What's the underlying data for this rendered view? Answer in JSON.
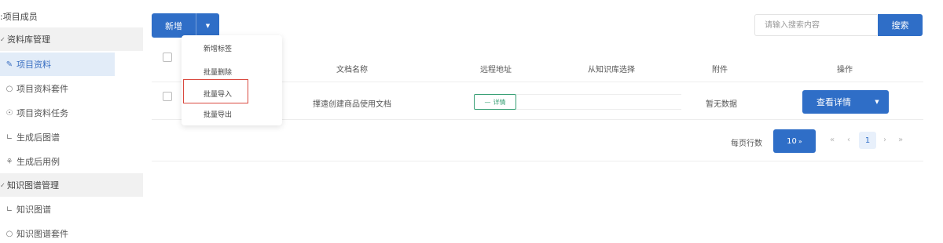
{
  "sidebar": {
    "top_item": ":项目成员",
    "groups": [
      {
        "label": "资料库管理",
        "items": [
          {
            "label": "项目资料",
            "icon": "edit-icon",
            "active": true
          },
          {
            "label": "项目资料套件",
            "icon": "circle-icon",
            "active": false
          },
          {
            "label": "项目资料任务",
            "icon": "play-circle-icon",
            "active": false
          },
          {
            "label": "生成后图谱",
            "icon": "line-chart-icon",
            "active": false
          },
          {
            "label": "生成后用例",
            "icon": "bug-icon",
            "active": false
          }
        ]
      },
      {
        "label": "知识图谱管理",
        "items": [
          {
            "label": "知识图谱",
            "icon": "line-chart-icon",
            "active": false
          },
          {
            "label": "知识图谱套件",
            "icon": "circle-icon",
            "active": false
          }
        ]
      }
    ]
  },
  "toolbar": {
    "new_label": "新增",
    "new_menu": [
      "新增标签",
      "批量删除",
      "批量导入",
      "批量导出"
    ],
    "highlighted_menu_item": "批量导入",
    "search_placeholder": "请输入搜索内容",
    "search_label": "搜索"
  },
  "table": {
    "headers": [
      "文档名称",
      "远程地址",
      "从知识库选择",
      "附件",
      "操作"
    ],
    "rows": [
      {
        "name": "擇遠创建商品使用文档",
        "remote_tag": "详情",
        "kb_select": "",
        "attachment": "暂无数据",
        "action": "查看详情"
      }
    ]
  },
  "pagination": {
    "rows_per_page_label": "每页行数",
    "page_size": "10",
    "first": "«",
    "prev": "‹",
    "current_page": "1",
    "next": "›",
    "last": "»"
  },
  "colors": {
    "primary": "#2f6ec7",
    "active_bg": "#e2ecf8",
    "tag_green": "#3aa076",
    "highlight_red": "#d9493f"
  }
}
